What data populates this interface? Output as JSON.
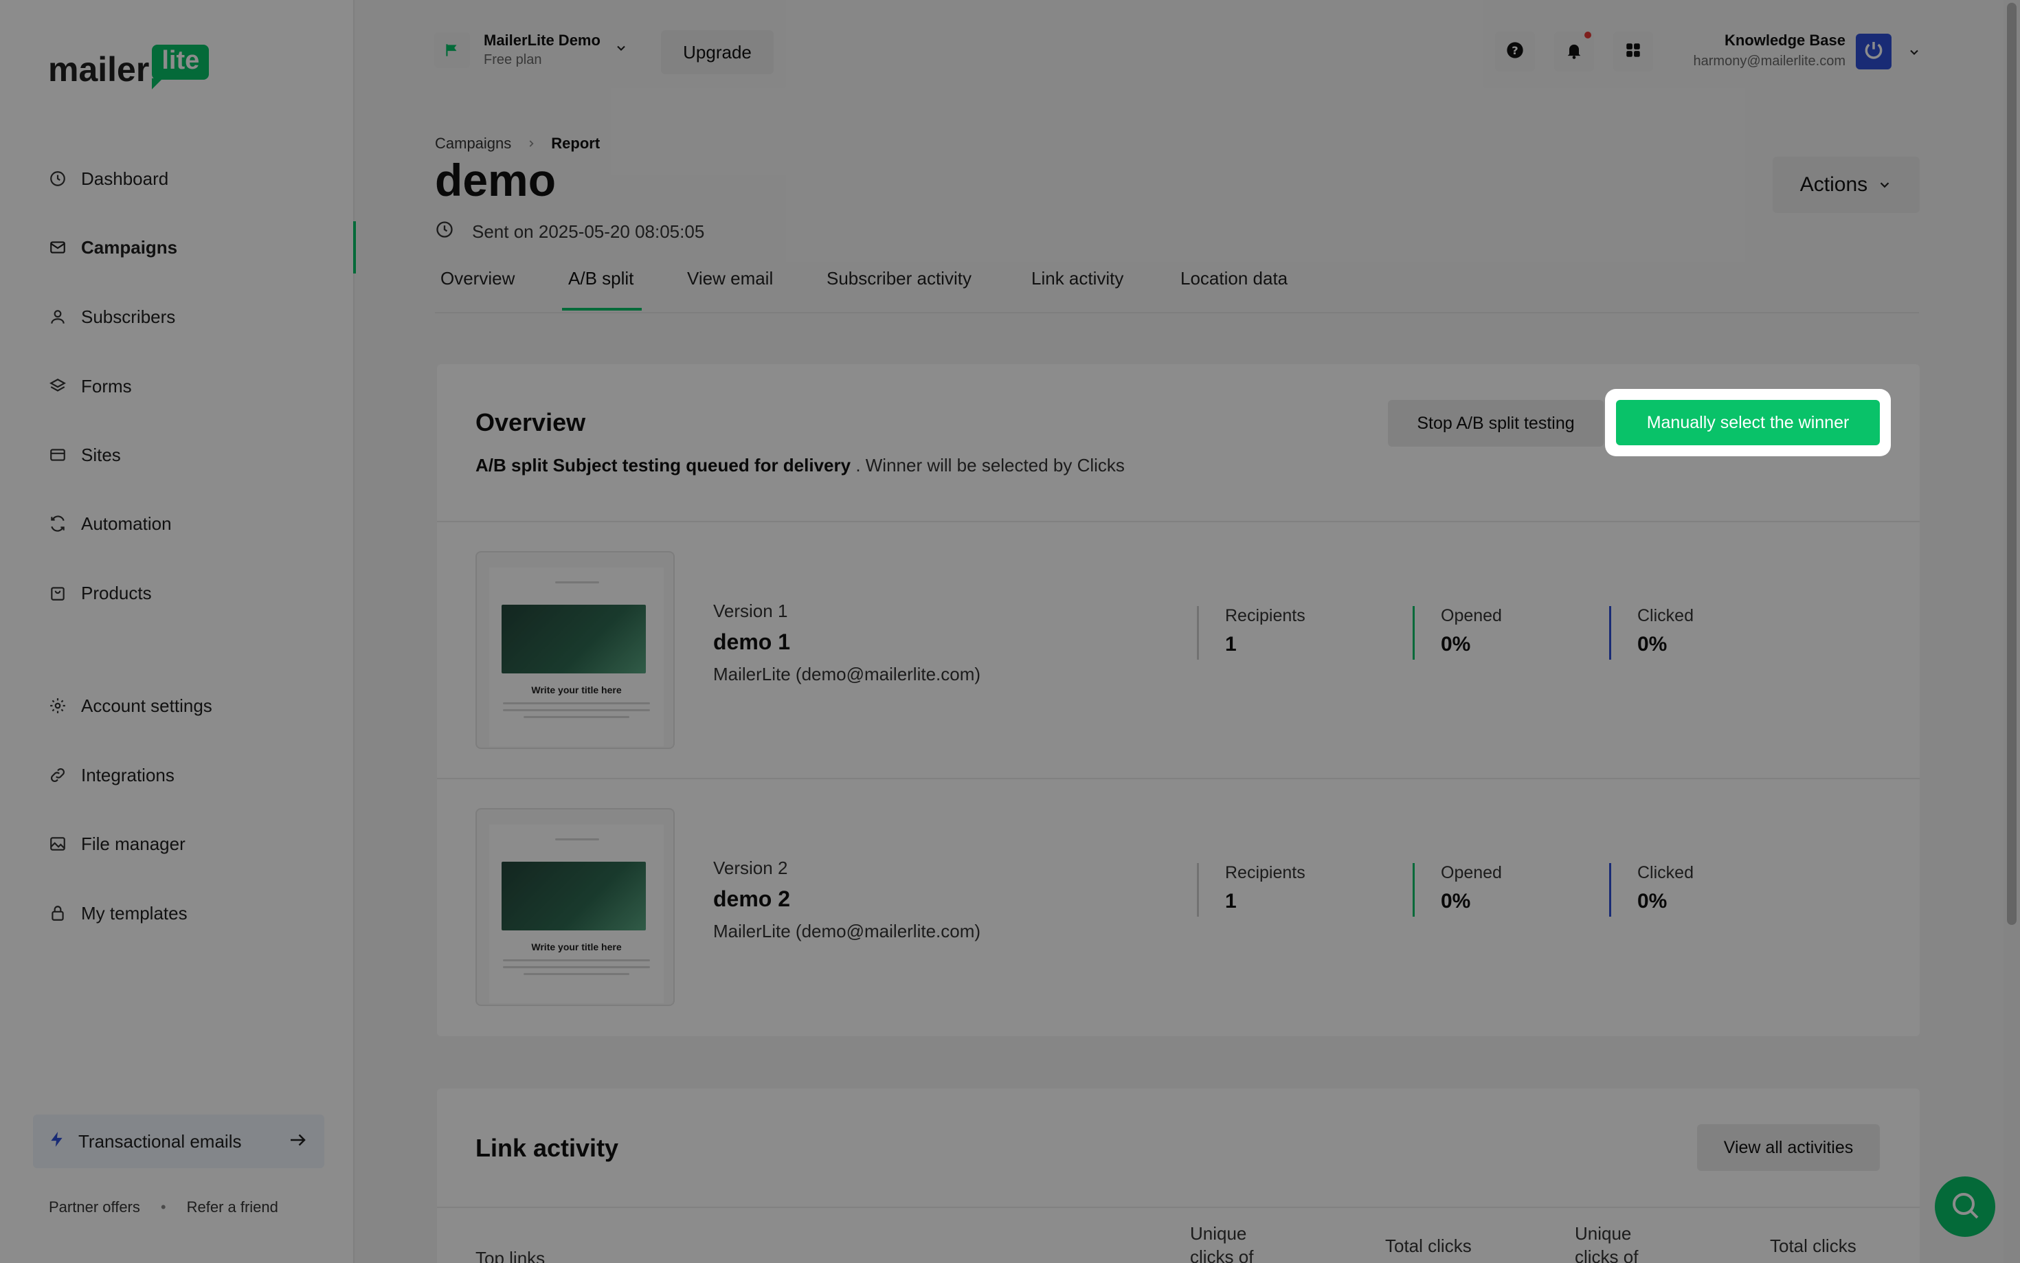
{
  "brand": {
    "logo_main": "mailer",
    "logo_badge": "lite",
    "accent": "#09c269",
    "blue": "#2e4fd6"
  },
  "sidebar": {
    "items": [
      {
        "label": "Dashboard",
        "icon": "clock-icon"
      },
      {
        "label": "Campaigns",
        "icon": "mail-icon",
        "active": true
      },
      {
        "label": "Subscribers",
        "icon": "person-icon"
      },
      {
        "label": "Forms",
        "icon": "layers-icon"
      },
      {
        "label": "Sites",
        "icon": "browser-icon"
      },
      {
        "label": "Automation",
        "icon": "refresh-icon"
      },
      {
        "label": "Products",
        "icon": "bag-icon"
      },
      {
        "label": "Account settings",
        "icon": "gear-icon"
      },
      {
        "label": "Integrations",
        "icon": "link-icon"
      },
      {
        "label": "File manager",
        "icon": "image-icon"
      },
      {
        "label": "My templates",
        "icon": "lock-icon"
      }
    ],
    "transactional": "Transactional emails",
    "footer": {
      "partner": "Partner offers",
      "refer": "Refer a friend"
    }
  },
  "topbar": {
    "account_name": "MailerLite Demo",
    "account_plan": "Free plan",
    "upgrade": "Upgrade",
    "user_name": "Knowledge Base",
    "user_email": "harmony@mailerlite.com"
  },
  "header": {
    "breadcrumb": [
      "Campaigns",
      "Report"
    ],
    "title": "demo",
    "sent": "Sent on 2025-05-20 08:05:05",
    "actions": "Actions",
    "tabs": [
      "Overview",
      "A/B split",
      "View email",
      "Subscriber activity",
      "Link activity",
      "Location data"
    ],
    "active_tab": "A/B split"
  },
  "overview": {
    "title": "Overview",
    "subtitle_bold": "A/B split Subject testing queued for delivery",
    "subtitle_rest": " . Winner will be selected by Clicks",
    "stop_button": "Stop A/B split testing",
    "winner_button": "Manually select the winner",
    "versions": [
      {
        "label": "Version 1",
        "name": "demo 1",
        "from": "MailerLite (demo@mailerlite.com)",
        "recipients": "1",
        "opened": "0%",
        "clicked": "0%"
      },
      {
        "label": "Version 2",
        "name": "demo 2",
        "from": "MailerLite (demo@mailerlite.com)",
        "recipients": "1",
        "opened": "0%",
        "clicked": "0%"
      }
    ],
    "stat_labels": {
      "recipients": "Recipients",
      "opened": "Opened",
      "clicked": "Clicked"
    },
    "thumb_title": "Write your title here"
  },
  "link_activity": {
    "title": "Link activity",
    "view_all": "View all activities",
    "columns": [
      "Top links",
      "Unique clicks of",
      "Total clicks",
      "Unique clicks of",
      "Total clicks"
    ]
  }
}
